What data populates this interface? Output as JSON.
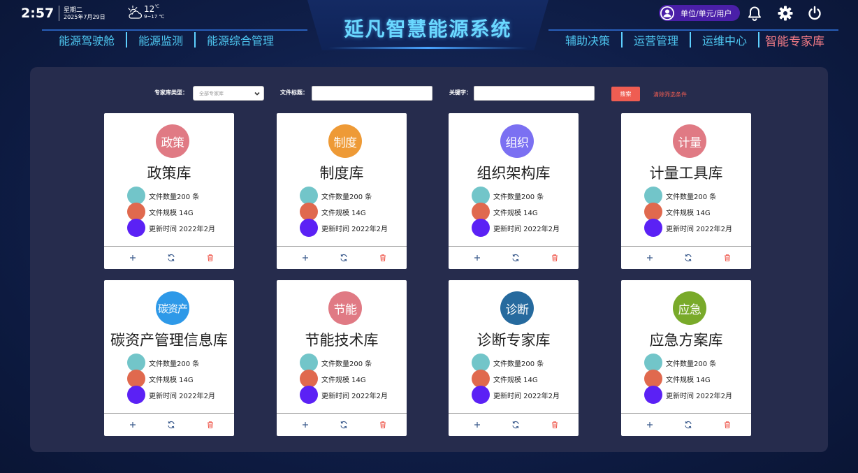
{
  "status": {
    "time": "2:57",
    "weekday": "星期二",
    "date": "2025年7月29日",
    "temperature": "12",
    "temp_unit": "℃",
    "temp_range": "9~17 ℃"
  },
  "header": {
    "title": "延凡智慧能源系统",
    "user_label": "单位/单元/用户"
  },
  "nav": {
    "left": [
      "能源驾驶舱",
      "能源监测",
      "能源综合管理"
    ],
    "right": [
      "辅助决策",
      "运营管理",
      "运维中心",
      "智能专家库"
    ],
    "active": "智能专家库"
  },
  "filters": {
    "type_label": "专家库类型：",
    "type_value": "全部专家库",
    "title_label": "文件标题：",
    "title_value": "",
    "keyword_label": "关键字：",
    "keyword_value": "",
    "search_label": "搜索",
    "clear_label": "清除筛选条件"
  },
  "stat_colors": [
    "#72c5c9",
    "#e0694e",
    "#5b21f5"
  ],
  "cards": [
    {
      "badge": "政策",
      "title": "政策库",
      "color": "#e07a84",
      "count": "文件数量200 条",
      "size": "文件规模 14G",
      "updated": "更新时间 2022年2月"
    },
    {
      "badge": "制度",
      "title": "制度库",
      "color": "#ee9a36",
      "count": "文件数量200 条",
      "size": "文件规模 14G",
      "updated": "更新时间 2022年2月"
    },
    {
      "badge": "组织",
      "title": "组织架构库",
      "color": "#7b70f2",
      "count": "文件数量200 条",
      "size": "文件规模 14G",
      "updated": "更新时间 2022年2月"
    },
    {
      "badge": "计量",
      "title": "计量工具库",
      "color": "#e07a84",
      "count": "文件数量200 条",
      "size": "文件规模 14G",
      "updated": "更新时间 2022年2月"
    },
    {
      "badge": "碳资产",
      "title": "碳资产管理信息库",
      "color": "#2e99e8",
      "count": "文件数量200 条",
      "size": "文件规模 14G",
      "updated": "更新时间 2022年2月"
    },
    {
      "badge": "节能",
      "title": "节能技术库",
      "color": "#e07a84",
      "count": "文件数量200 条",
      "size": "文件规模 14G",
      "updated": "更新时间 2022年2月"
    },
    {
      "badge": "诊断",
      "title": "诊断专家库",
      "color": "#266a9e",
      "count": "文件数量200 条",
      "size": "文件规模 14G",
      "updated": "更新时间 2022年2月"
    },
    {
      "badge": "应急",
      "title": "应急方案库",
      "color": "#79aa2a",
      "count": "文件数量200 条",
      "size": "文件规模 14G",
      "updated": "更新时间 2022年2月"
    }
  ]
}
